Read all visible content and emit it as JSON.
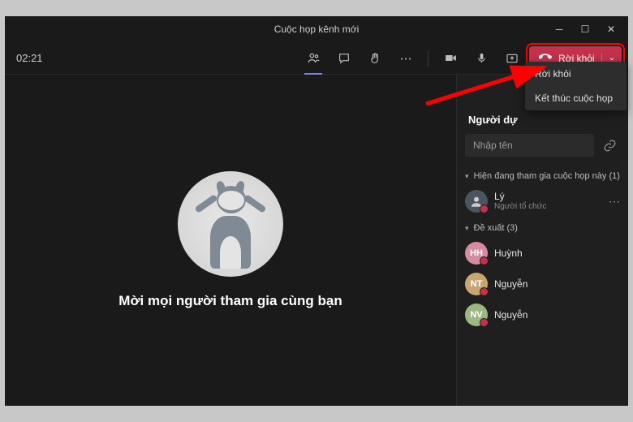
{
  "window": {
    "title": "Cuộc họp kênh mới"
  },
  "toolbar": {
    "timer": "02:21",
    "leave_label": "Rời khỏi"
  },
  "dropdown": {
    "items": [
      {
        "label": "Rời khỏi"
      },
      {
        "label": "Kết thúc cuộc họp"
      }
    ]
  },
  "main": {
    "invite_text": "Mời mọi người tham gia cùng bạn"
  },
  "side": {
    "title": "Người dự",
    "search_placeholder": "Nhập tên",
    "sections": [
      {
        "label": "Hiện đang tham gia cuộc họp này (1)",
        "people": [
          {
            "name": "Lý",
            "role": "Người tổ chức",
            "badge": "img",
            "initials": ""
          }
        ]
      },
      {
        "label": "Đề xuất (3)",
        "people": [
          {
            "name": "Huỳnh",
            "role": "",
            "badge": "hh",
            "initials": "HH"
          },
          {
            "name": "Nguyễn",
            "role": "",
            "badge": "nt",
            "initials": "NT"
          },
          {
            "name": "Nguyễn",
            "role": "",
            "badge": "nv",
            "initials": "NV"
          }
        ]
      }
    ]
  }
}
